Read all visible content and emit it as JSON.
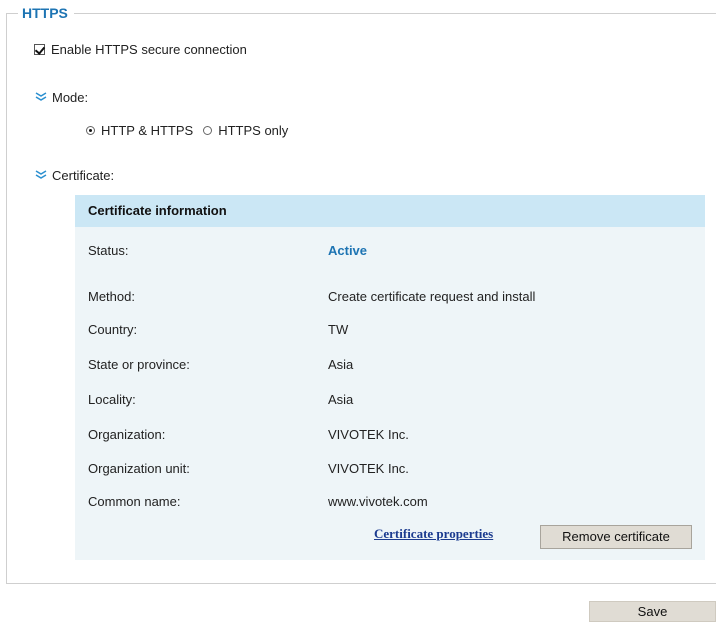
{
  "section": {
    "title": "HTTPS"
  },
  "enable_https": {
    "label": "Enable HTTPS secure connection",
    "checked": true
  },
  "mode": {
    "label": "Mode:",
    "options": [
      {
        "label": "HTTP & HTTPS",
        "selected": true
      },
      {
        "label": "HTTPS only",
        "selected": false
      }
    ]
  },
  "certificate": {
    "label": "Certificate:",
    "panel_title": "Certificate information",
    "rows": [
      {
        "label": "Status:",
        "value": "Active"
      },
      {
        "label": "Method:",
        "value": "Create certificate request and install"
      },
      {
        "label": "Country:",
        "value": "TW"
      },
      {
        "label": "State or province:",
        "value": "Asia"
      },
      {
        "label": "Locality:",
        "value": "Asia"
      },
      {
        "label": "Organization:",
        "value": "VIVOTEK Inc."
      },
      {
        "label": "Organization unit:",
        "value": "VIVOTEK Inc."
      },
      {
        "label": "Common name:",
        "value": "www.vivotek.com"
      }
    ],
    "properties_link": "Certificate properties",
    "remove_button": "Remove certificate"
  },
  "save_button": "Save",
  "colors": {
    "accent": "#1d74b3",
    "panel_header": "#cbe7f5",
    "panel_bg": "#eef5f8",
    "link": "#1b3b8f"
  },
  "icons": {
    "section_toggle": "chevron-double-down-icon"
  }
}
